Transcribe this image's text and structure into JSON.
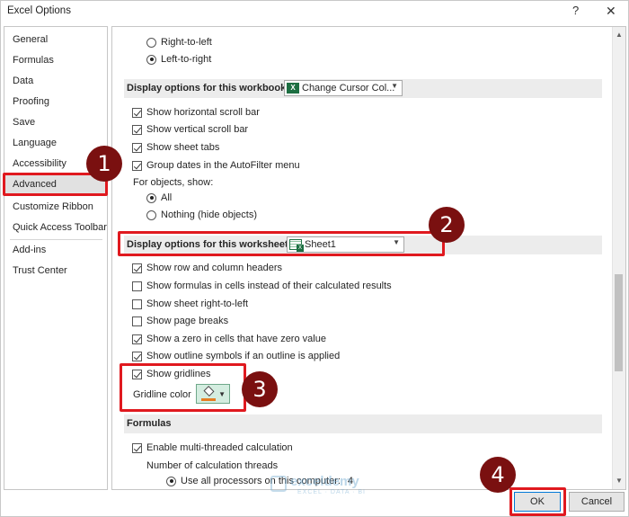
{
  "window": {
    "title": "Excel Options",
    "help": "?",
    "close": "✕"
  },
  "sidebar": {
    "items": [
      {
        "label": "General"
      },
      {
        "label": "Formulas"
      },
      {
        "label": "Data"
      },
      {
        "label": "Proofing"
      },
      {
        "label": "Save"
      },
      {
        "label": "Language"
      },
      {
        "label": "Accessibility"
      },
      {
        "label": "Advanced",
        "selected": true
      },
      {
        "label": "Customize Ribbon"
      },
      {
        "label": "Quick Access Toolbar"
      },
      {
        "label": "Add-ins"
      },
      {
        "label": "Trust Center"
      }
    ]
  },
  "direction": {
    "right_to_left": "Right-to-left",
    "left_to_right": "Left-to-right"
  },
  "workbook_section": {
    "label": "Display options for this workbook:",
    "combo_value": "Change Cursor Col...",
    "options": [
      {
        "label": "Show horizontal scroll bar",
        "checked": true
      },
      {
        "label": "Show vertical scroll bar",
        "checked": true
      },
      {
        "label": "Show sheet tabs",
        "checked": true
      },
      {
        "label": "Group dates in the AutoFilter menu",
        "checked": true
      }
    ],
    "objects_label": "For objects, show:",
    "objects_all": "All",
    "objects_nothing": "Nothing (hide objects)"
  },
  "worksheet_section": {
    "label": "Display options for this worksheet:",
    "combo_value": "Sheet1",
    "options": [
      {
        "label": "Show row and column headers",
        "checked": true
      },
      {
        "label": "Show formulas in cells instead of their calculated results",
        "checked": false
      },
      {
        "label": "Show sheet right-to-left",
        "checked": false
      },
      {
        "label": "Show page breaks",
        "checked": false
      },
      {
        "label": "Show a zero in cells that have zero value",
        "checked": true
      },
      {
        "label": "Show outline symbols if an outline is applied",
        "checked": true
      },
      {
        "label": "Show gridlines",
        "checked": true
      }
    ],
    "gridline_color_label": "Gridline color"
  },
  "formulas_section": {
    "label": "Formulas",
    "multithread": "Enable multi-threaded calculation",
    "threads_label": "Number of calculation threads",
    "all_processors": "Use all processors on this computer:",
    "processor_count": "4"
  },
  "buttons": {
    "ok": "OK",
    "cancel": "Cancel"
  },
  "badges": [
    "1",
    "2",
    "3",
    "4"
  ],
  "watermark": {
    "name": "exceldemy",
    "sub": "EXCEL · DATA · BI"
  },
  "colors": {
    "highlight": "#e0191f",
    "badge": "#7a1010",
    "selection": "#e1e1e1",
    "gridline_swatch": "#e67e22"
  }
}
